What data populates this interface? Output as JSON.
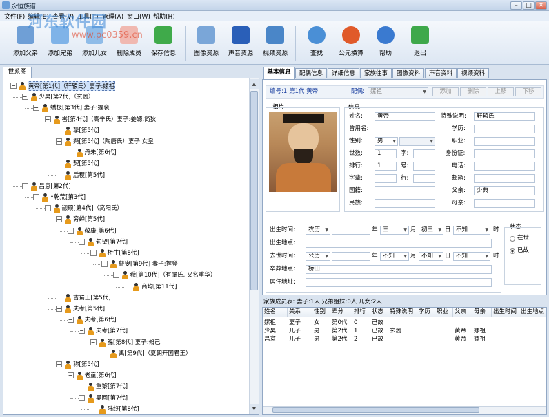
{
  "window": {
    "title": "永恒族谱"
  },
  "menu": [
    "文件(F)",
    "编辑(E)",
    "查看(V)",
    "工具(T)",
    "管理(A)",
    "窗口(W)",
    "帮助(H)"
  ],
  "watermark": {
    "line1": "河东软件园",
    "line2": "www.pc0359.cn"
  },
  "toolbar": {
    "buttons": [
      {
        "label": "添加父亲",
        "icon": "add-father-icon",
        "color": "#6f9fd6"
      },
      {
        "label": "添加兄弟",
        "icon": "add-sibling-icon",
        "color": "#7fb3e8"
      },
      {
        "label": "添加儿女",
        "icon": "add-child-icon",
        "color": "#8fbce8"
      },
      {
        "label": "删除成员",
        "icon": "delete-member-icon",
        "color": "#f0b8b0"
      },
      {
        "label": "保存信息",
        "icon": "save-icon",
        "color": "#3faa4a"
      },
      {
        "label": "图像资源",
        "icon": "image-icon",
        "color": "#7aa6d8"
      },
      {
        "label": "声音资源",
        "icon": "music-icon",
        "color": "#2a5fb8"
      },
      {
        "label": "视频资源",
        "icon": "video-icon",
        "color": "#4a86c8"
      },
      {
        "label": "查找",
        "icon": "search-icon",
        "color": "#4a8fd6"
      },
      {
        "label": "公元换算",
        "icon": "convert-icon",
        "color": "#e05a2a"
      },
      {
        "label": "帮助",
        "icon": "help-icon",
        "color": "#3a7ad0"
      },
      {
        "label": "退出",
        "icon": "exit-icon",
        "color": "#3ea84a"
      }
    ]
  },
  "left_tab": "世系图",
  "tree": [
    {
      "text": "黄帝[第1代]（轩辕氏）妻子:嫘祖",
      "level": 0,
      "selected": true
    },
    {
      "text": "少昊[第2代]（玄嚣）",
      "level": 1
    },
    {
      "text": "蟜极[第3代] 妻子:握裒",
      "level": 2
    },
    {
      "text": "喾[第4代]（高辛氏）妻子:姜嫄,简狄",
      "level": 3
    },
    {
      "text": "挚[第5代]",
      "level": 4
    },
    {
      "text": "尧[第5代]（陶唐氏）妻子:女皇",
      "level": 4
    },
    {
      "text": "丹朱[第6代]",
      "level": 5
    },
    {
      "text": "契[第5代]",
      "level": 4
    },
    {
      "text": "后稷[第5代]",
      "level": 4
    },
    {
      "text": "昌意[第2代]",
      "level": 1
    },
    {
      "text": "•乾荒[第3代]",
      "level": 2
    },
    {
      "text": "颛顼[第4代]（高阳氏）",
      "level": 3
    },
    {
      "text": "穷蝉[第5代]",
      "level": 4
    },
    {
      "text": "敬康[第6代]",
      "level": 5
    },
    {
      "text": "句望[第7代]",
      "level": 6
    },
    {
      "text": "桥牛[第8代]",
      "level": 7
    },
    {
      "text": "瞽叟[第9代] 妻子:握登",
      "level": 8
    },
    {
      "text": "舜[第10代]（有虞氏, 又名重华）",
      "level": 9
    },
    {
      "text": "商均[第11代]",
      "level": 10
    },
    {
      "text": "吉蜀王[第5代]",
      "level": 4
    },
    {
      "text": "夫考[第5代]",
      "level": 4
    },
    {
      "text": "夫考[第6代]",
      "level": 5
    },
    {
      "text": "夫考[第7代]",
      "level": 6
    },
    {
      "text": "鲧[第8代] 妻子:脩已",
      "level": 7
    },
    {
      "text": "禹[第9代]（夏朝开国君王）",
      "level": 8
    },
    {
      "text": "称[第5代]",
      "level": 4
    },
    {
      "text": "老童[第6代]",
      "level": 5
    },
    {
      "text": "重黎[第7代]",
      "level": 6
    },
    {
      "text": "吴回[第7代]",
      "level": 6
    },
    {
      "text": "陆终[第8代]",
      "level": 7
    }
  ],
  "tabs": [
    "基本信息",
    "配偶信息",
    "详细信息",
    "家族往事",
    "图像资料",
    "声音资料",
    "视频资料"
  ],
  "topline": {
    "id_label": "编号:1 第1代 黄帝",
    "spouse_label": "配偶:",
    "spouse_value": "嫘祖",
    "add": "添加",
    "delete": "删除",
    "up": "上移",
    "down": "下移"
  },
  "photo_label": "相片",
  "info_label": "信息",
  "fields": {
    "name": {
      "label": "姓名:",
      "value": "黄帝"
    },
    "former": {
      "label": "曾用名:",
      "value": ""
    },
    "gender": {
      "label": "性别:",
      "value": "男"
    },
    "gen": {
      "label": "世数:",
      "value": "1"
    },
    "rank": {
      "label": "排行:",
      "value": "1"
    },
    "zibei": {
      "label": "字辈:",
      "value": ""
    },
    "country": {
      "label": "国籍:",
      "value": ""
    },
    "ethnic": {
      "label": "民族:",
      "value": ""
    },
    "zi": {
      "label": "字:",
      "value": ""
    },
    "hao": {
      "label": "号:",
      "value": ""
    },
    "hang": {
      "label": "行:",
      "value": ""
    },
    "special": {
      "label": "特殊说明:",
      "value": "轩辕氏"
    },
    "edu": {
      "label": "学历:",
      "value": ""
    },
    "job": {
      "label": "职业:",
      "value": ""
    },
    "idcard": {
      "label": "身份证:",
      "value": ""
    },
    "phone": {
      "label": "电话:",
      "value": ""
    },
    "email": {
      "label": "邮箱:",
      "value": ""
    },
    "father": {
      "label": "父亲:",
      "value": "少典"
    },
    "mother": {
      "label": "母亲:",
      "value": ""
    }
  },
  "dates": {
    "birth_label": "出生时间:",
    "birth_cal": "农历",
    "birth_month": "三",
    "birth_day": "初三",
    "birth_hour": "不知",
    "birthplace_label": "出生地点:",
    "death_label": "去世时间:",
    "death_cal": "公历",
    "death_month": "不知",
    "death_day": "不知",
    "death_hour": "不知",
    "burial_label": "卒葬地点:",
    "burial_value": "桥山",
    "residence_label": "居住地址:",
    "year": "年",
    "month": "月",
    "day": "日",
    "hour": "时"
  },
  "status": {
    "label": "状态",
    "alive": "在世",
    "dead": "已故"
  },
  "summary": "家族成员表: 妻子:1人 兄弟姐妹:0人 儿女:2人",
  "table": {
    "headers": [
      "姓名",
      "关系",
      "性别",
      "辈分",
      "排行",
      "状态",
      "特殊说明",
      "学历",
      "职业",
      "父亲",
      "母亲",
      "出生时间",
      "出生地点",
      "去世"
    ],
    "rows": [
      [
        "嫘祖",
        "妻子",
        "女",
        "第0代",
        "0",
        "已故",
        "",
        "",
        "",
        "",
        "",
        "",
        "",
        ""
      ],
      [
        "少昊",
        "儿子",
        "男",
        "第2代",
        "1",
        "已故",
        "玄嚣",
        "",
        "",
        "黄帝",
        "嫘祖",
        "",
        "",
        ""
      ],
      [
        "昌意",
        "儿子",
        "男",
        "第2代",
        "2",
        "已故",
        "",
        "",
        "",
        "黄帝",
        "嫘祖",
        "",
        "",
        ""
      ]
    ]
  }
}
